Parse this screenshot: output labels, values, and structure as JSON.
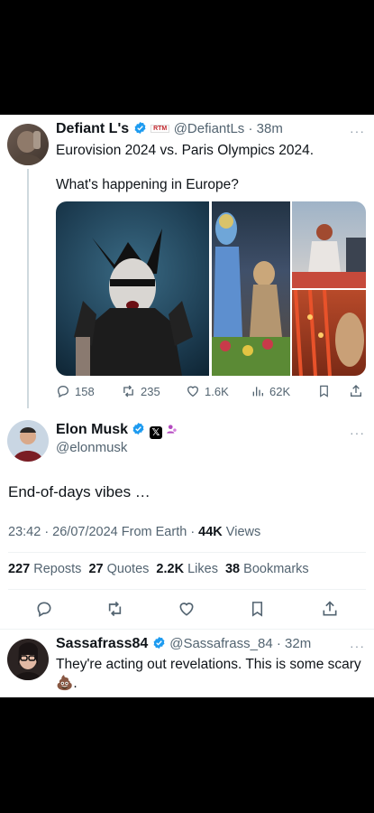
{
  "tweet1": {
    "name": "Defiant L's",
    "badge_text": "RTM",
    "handle": "@DefiantLs",
    "time": "38m",
    "text_line1": "Eurovision 2024 vs. Paris Olympics 2024.",
    "text_line2": "What's happening in Europe?",
    "stats": {
      "replies": "158",
      "reposts": "235",
      "likes": "1.6K",
      "views": "62K"
    }
  },
  "tweet2": {
    "name": "Elon Musk",
    "handle": "@elonmusk",
    "text": "End-of-days vibes …",
    "meta_time": "23:42 · 26/07/2024 From Earth · ",
    "meta_views_count": "44K",
    "meta_views_label": " Views",
    "counts": {
      "reposts_num": "227",
      "reposts_label": " Reposts",
      "quotes_num": "27",
      "quotes_label": " Quotes",
      "likes_num": "2.2K",
      "likes_label": " Likes",
      "bookmarks_num": "38",
      "bookmarks_label": " Bookmarks"
    }
  },
  "tweet3": {
    "name": "Sassafrass84",
    "handle": "@Sassafrass_84",
    "time": "32m",
    "text": "They're acting out revelations. This is some scary",
    "emoji": "💩",
    "text_end": "."
  },
  "colors": {
    "verified": "#1d9bf0",
    "text": "#0f1419",
    "muted": "#536471",
    "border": "#eff3f4"
  }
}
